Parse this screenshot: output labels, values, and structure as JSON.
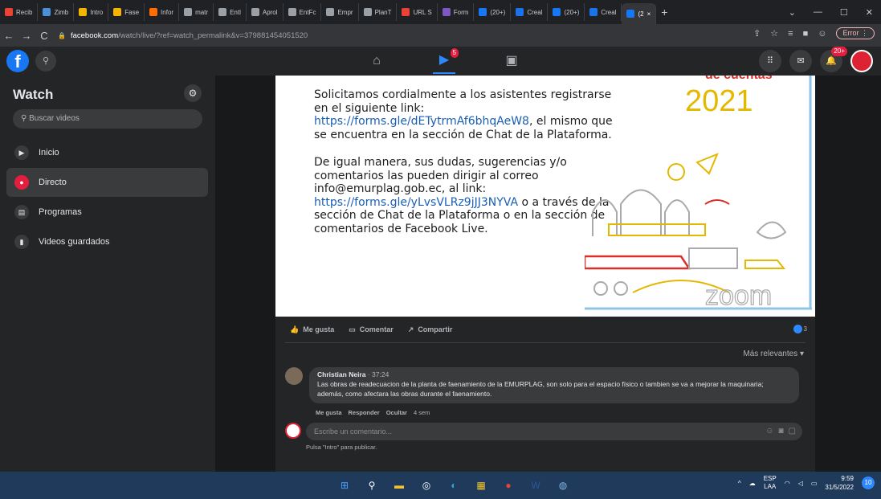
{
  "browser": {
    "tabs": [
      {
        "label": "Recib",
        "color": "#ea4335"
      },
      {
        "label": "Zimb",
        "color": "#4a90d9"
      },
      {
        "label": "Intro",
        "color": "#f4b400"
      },
      {
        "label": "Fase",
        "color": "#f4b400"
      },
      {
        "label": "Infor",
        "color": "#ff6d00"
      },
      {
        "label": "matr",
        "color": "#9aa0a6"
      },
      {
        "label": "Entl",
        "color": "#9aa0a6"
      },
      {
        "label": "Aprol",
        "color": "#9aa0a6"
      },
      {
        "label": "EntFc",
        "color": "#9aa0a6"
      },
      {
        "label": "Empr",
        "color": "#9aa0a6"
      },
      {
        "label": "PlanT",
        "color": "#9aa0a6"
      },
      {
        "label": "URL S",
        "color": "#ea4335"
      },
      {
        "label": "Form",
        "color": "#7e57c2"
      },
      {
        "label": "(20+)",
        "color": "#1877f2"
      },
      {
        "label": "Creal",
        "color": "#1a73e8"
      },
      {
        "label": "(20+)",
        "color": "#1877f2"
      },
      {
        "label": "Creal",
        "color": "#1a73e8"
      }
    ],
    "active_tab": {
      "label": "(2",
      "close": "×"
    },
    "new_tab": "+",
    "url_host": "facebook.com",
    "url_path": "/watch/live/?ref=watch_permalink&v=379881454051520",
    "error_label": "Error"
  },
  "fb": {
    "logo": "f",
    "video_badge": "5",
    "notif_badge": "20+"
  },
  "sidebar": {
    "title": "Watch",
    "search_placeholder": "Buscar videos",
    "items": [
      {
        "label": "Inicio",
        "icon": "play-icon"
      },
      {
        "label": "Directo",
        "icon": "live-icon"
      },
      {
        "label": "Programas",
        "icon": "clapper-icon"
      },
      {
        "label": "Videos guardados",
        "icon": "bookmark-icon"
      }
    ]
  },
  "video": {
    "para1_a": "Solicitamos cordialmente a los asistentes registrarse en el siguiente link: ",
    "para1_link": "https://forms.gle/dETytrmAf6bhqAeW8",
    "para1_b": ", el mismo que se encuentra en la sección de Chat de la Plataforma.",
    "para2_a": "De igual manera, sus dudas, sugerencias y/o comentarios las pueden dirigir al correo info@emurplag.gob.ec, al link: ",
    "para2_link": "https://forms.gle/yLvsVLRz9jJJ3NYVA",
    "para2_b": " o a través de la sección de Chat de la Plataforma o en la sección de comentarios de Facebook Live.",
    "top_text": "de cuentas",
    "year_text": "2021",
    "zoom_text": "zoom",
    "accent_red": "#d9302c",
    "accent_yellow": "#e5b800"
  },
  "actions": {
    "like": "Me gusta",
    "comment": "Comentar",
    "share": "Compartir",
    "reaction_count": "3"
  },
  "comments": {
    "sort_label": "Más relevantes",
    "author": "Christian Neira",
    "time": "37:24",
    "text": "Las obras de readecuacion de la planta de faenamiento de la EMURPLAG, son solo para el espacio físico o tambien se va a mejorar la maquinaria; además, como afectara las obras durante el faenamiento.",
    "like": "Me gusta",
    "reply": "Responder",
    "hide": "Ocultar",
    "age": "4 sem",
    "input_placeholder": "Escribe un comentario...",
    "hint": "Pulsa \"Intro\" para publicar."
  },
  "taskbar": {
    "lang_top": "ESP",
    "lang_bottom": "LAA",
    "time": "9:59",
    "date": "31/5/2022",
    "notif_count": "10"
  }
}
